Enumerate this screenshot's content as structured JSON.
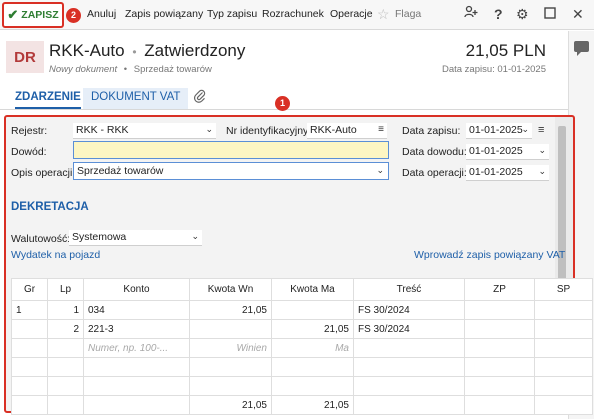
{
  "toolbar": {
    "save_label": "ZAPISZ",
    "save_badge": "2",
    "items": [
      "Anuluj",
      "Zapis powiązany",
      "Typ zapisu",
      "Rozrachunek",
      "Operacje",
      "Flaga"
    ],
    "icons": [
      "add-person-icon",
      "help-icon",
      "gear-icon",
      "maximize-icon",
      "close-icon"
    ]
  },
  "header": {
    "badge": "DR",
    "title": "RKK-Auto",
    "separator": "•",
    "status": "Zatwierdzony",
    "subtitle_left": "Nowy dokument",
    "subtitle_sep": "•",
    "subtitle_right": "Sprzedaż towarów",
    "amount": "21,05 PLN",
    "date_info": "Data zapisu: 01-01-2025"
  },
  "tabs": {
    "event": "ZDARZENIE",
    "vat": "DOKUMENT VAT"
  },
  "annotation_badge": "1",
  "form": {
    "rejestr_label": "Rejestr:",
    "rejestr_value": "RKK - RKK",
    "nr_label": "Nr identyfikacyjny:",
    "nr_value": "RKK-Auto",
    "data_zapisu_label": "Data zapisu:",
    "data_zapisu_value": "01-01-2025",
    "dowod_label": "Dowód:",
    "dowod_value": "",
    "data_dowodu_label": "Data dowodu:",
    "data_dowodu_value": "01-01-2025",
    "opis_label": "Opis operacji:",
    "opis_value": "Sprzedaż towarów",
    "data_operacji_label": "Data operacji:",
    "data_operacji_value": "01-01-2025"
  },
  "dekretacja": {
    "title": "DEKRETACJA",
    "waluta_label": "Walutowość:",
    "waluta_value": "Systemowa",
    "link_left": "Wydatek na pojazd",
    "link_right": "Wprowadź zapis powiązany VAT"
  },
  "table": {
    "headers": [
      "Gr",
      "Lp",
      "Konto",
      "Kwota Wn",
      "Kwota Ma",
      "Treść",
      "ZP",
      "SP"
    ],
    "rows": [
      {
        "gr": "1",
        "lp": "1",
        "konto": "034",
        "wn": "21,05",
        "ma": "",
        "tresc": "FS 30/2024"
      },
      {
        "gr": "",
        "lp": "2",
        "konto": "221-3",
        "wn": "",
        "ma": "21,05",
        "tresc": "FS 30/2024"
      }
    ],
    "placeholders": {
      "konto": "Numer, np. 100-...",
      "wn": "Winien",
      "ma": "Ma"
    },
    "totals": {
      "wn": "21,05",
      "ma": "21,05"
    }
  }
}
